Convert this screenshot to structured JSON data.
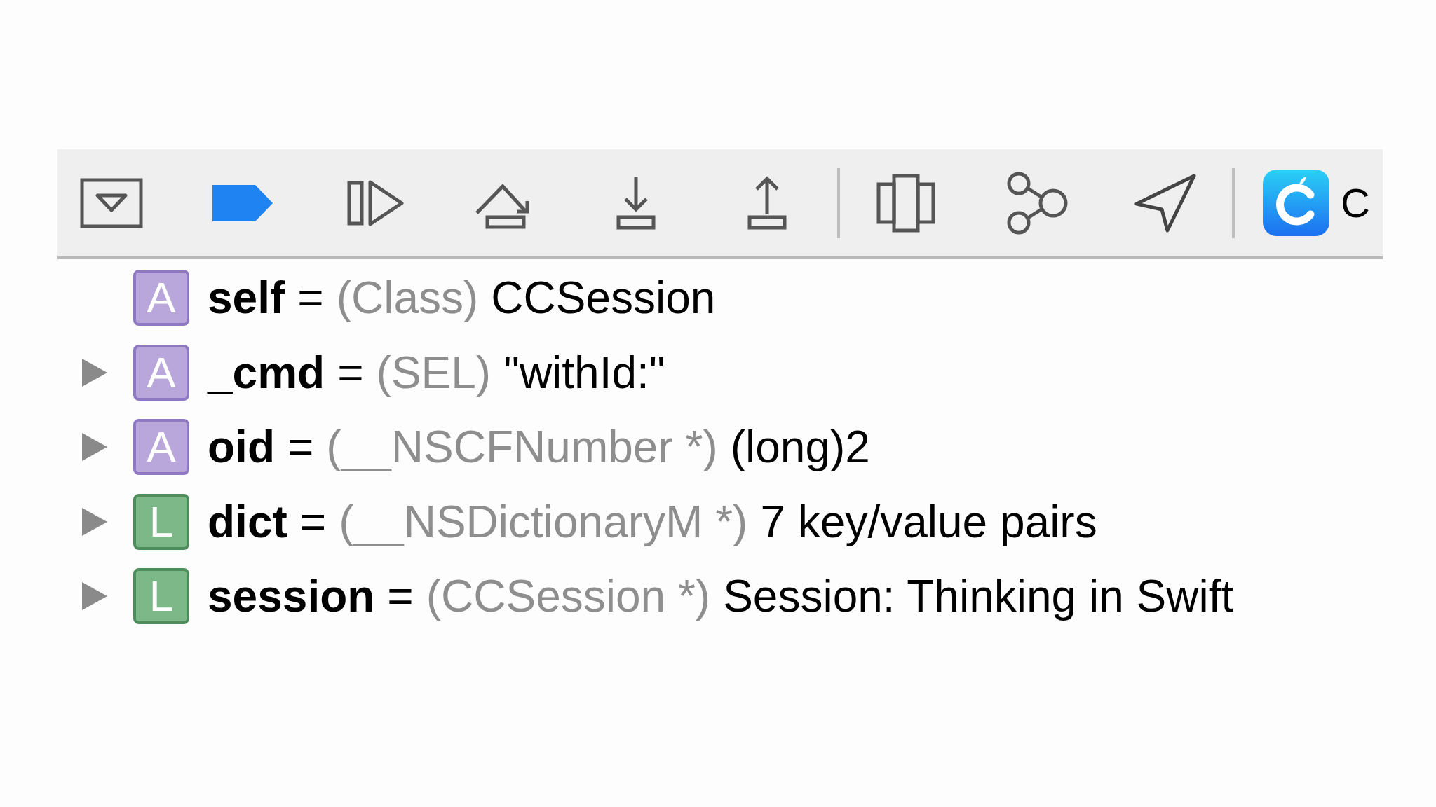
{
  "toolbar": {
    "trailing_text": "C"
  },
  "variables": [
    {
      "expandable": false,
      "kind": "argument",
      "badge": "A",
      "name": "self",
      "equals": "=",
      "type": "(Class)",
      "value": "CCSession"
    },
    {
      "expandable": true,
      "kind": "argument",
      "badge": "A",
      "name": "_cmd",
      "equals": "=",
      "type": "(SEL)",
      "value": "\"withId:\""
    },
    {
      "expandable": true,
      "kind": "argument",
      "badge": "A",
      "name": "oid",
      "equals": "=",
      "type": "(__NSCFNumber *)",
      "value": "(long)2"
    },
    {
      "expandable": true,
      "kind": "local",
      "badge": "L",
      "name": "dict",
      "equals": "=",
      "type": "(__NSDictionaryM *)",
      "value": "7 key/value pairs"
    },
    {
      "expandable": true,
      "kind": "local",
      "badge": "L",
      "name": "session",
      "equals": "=",
      "type": "(CCSession *)",
      "value": "Session: Thinking in Swift"
    }
  ]
}
